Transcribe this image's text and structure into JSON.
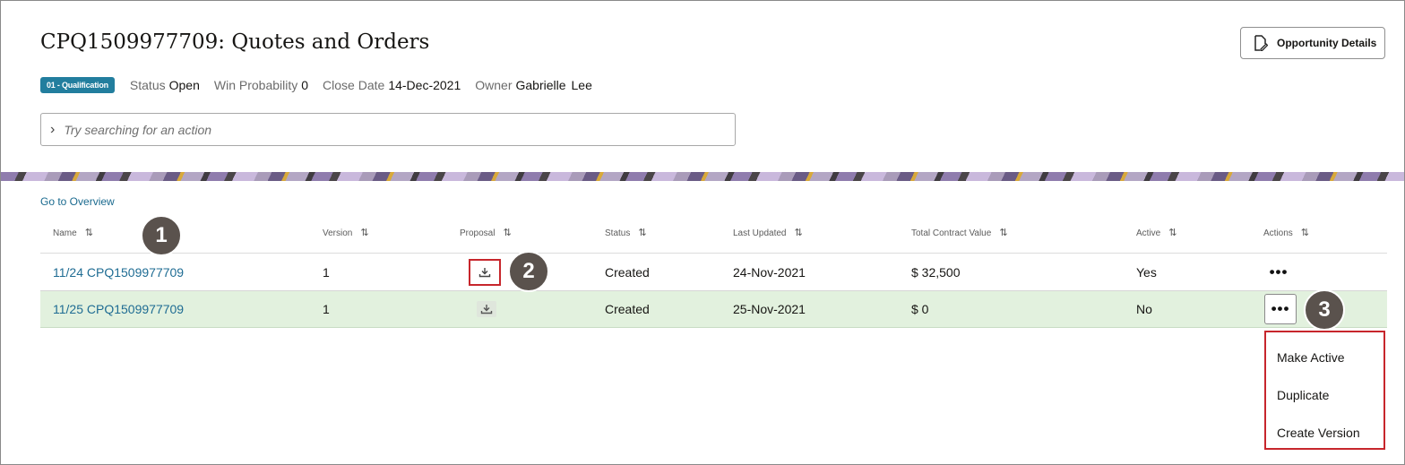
{
  "header": {
    "title": "CPQ1509977709: Quotes and Orders",
    "opportunity_button": "Opportunity Details"
  },
  "meta": {
    "stage_badge": "01 - Qualification",
    "status_label": "Status",
    "status_value": "Open",
    "win_label": "Win Probability",
    "win_value": "0",
    "close_label": "Close Date",
    "close_value": "14-Dec-2021",
    "owner_label": "Owner",
    "owner_first": "Gabrielle",
    "owner_last": "Lee"
  },
  "search": {
    "placeholder": "Try searching for an action"
  },
  "nav": {
    "go_overview": "Go to Overview"
  },
  "table": {
    "columns": [
      "Name",
      "Version",
      "Proposal",
      "Status",
      "Last Updated",
      "Total Contract Value",
      "Active",
      "Actions"
    ],
    "sort_icon": "⇅",
    "rows": [
      {
        "name": "11/24 CPQ1509977709",
        "version": "1",
        "status": "Created",
        "last_updated": "24-Nov-2021",
        "total": "$ 32,500",
        "active": "Yes"
      },
      {
        "name": "11/25 CPQ1509977709",
        "version": "1",
        "status": "Created",
        "last_updated": "25-Nov-2021",
        "total": "$ 0",
        "active": "No"
      }
    ],
    "actions_icon": "•••"
  },
  "actions_menu": {
    "items": [
      "Make Active",
      "Duplicate",
      "Create Version"
    ]
  },
  "callouts": [
    "1",
    "2",
    "3"
  ],
  "colors": {
    "accent_link": "#1f6c93",
    "badge": "#227e9e",
    "highlight_row": "#e2f1de",
    "callout_border": "#c7262c"
  }
}
